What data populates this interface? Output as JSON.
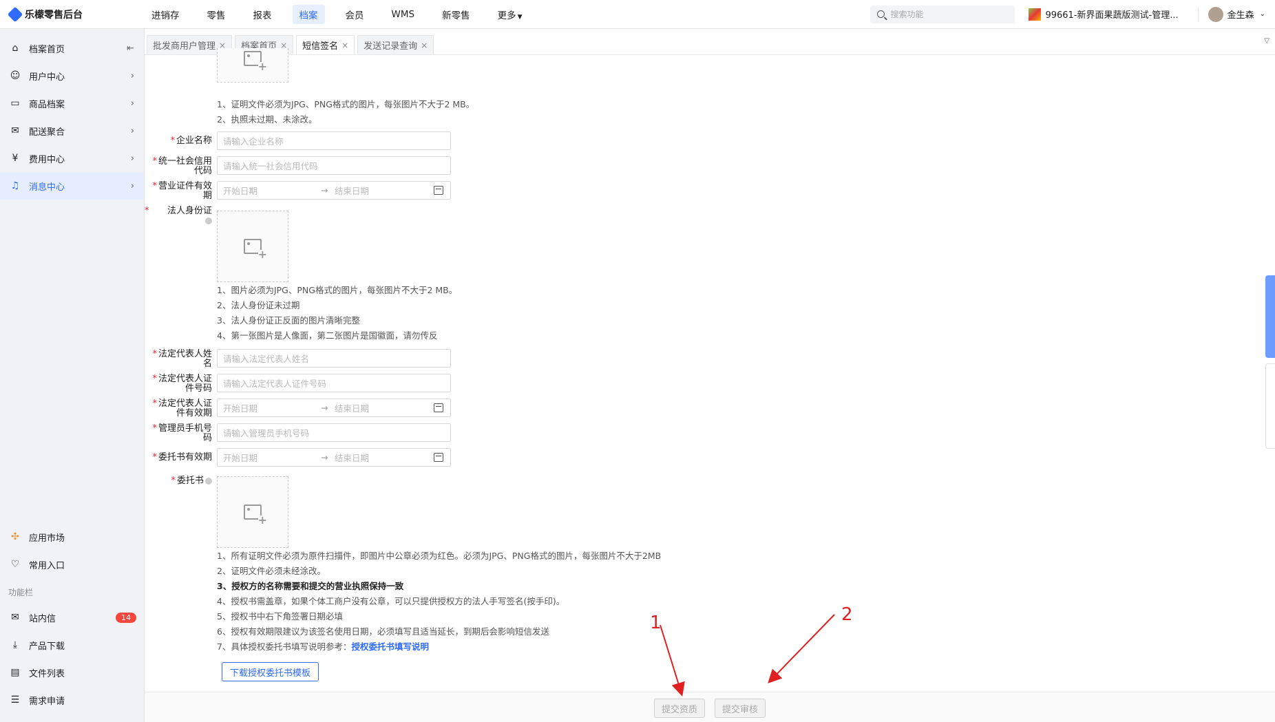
{
  "app": {
    "title": "乐檬零售后台"
  },
  "topnav": [
    {
      "label": "进销存",
      "active": false
    },
    {
      "label": "零售",
      "active": false
    },
    {
      "label": "报表",
      "active": false
    },
    {
      "label": "档案",
      "active": true
    },
    {
      "label": "会员",
      "active": false
    },
    {
      "label": "WMS",
      "active": false
    },
    {
      "label": "新零售",
      "active": false
    },
    {
      "label": "更多",
      "active": false
    }
  ],
  "search": {
    "placeholder": "搜索功能"
  },
  "store": {
    "name": "99661-新界面果蔬版测试-管理..."
  },
  "user": {
    "name": "金生森"
  },
  "sidebar": {
    "items": [
      {
        "label": "档案首页",
        "icon": "home-icon"
      },
      {
        "label": "用户中心",
        "icon": "user-icon"
      },
      {
        "label": "商品档案",
        "icon": "goods-icon"
      },
      {
        "label": "配送聚合",
        "icon": "delivery-icon"
      },
      {
        "label": "费用中心",
        "icon": "fee-icon"
      },
      {
        "label": "消息中心",
        "icon": "bell-icon",
        "active": true
      }
    ],
    "bottom": [
      {
        "label": "应用市场",
        "icon": "app-market-icon"
      },
      {
        "label": "常用入口",
        "icon": "heart-icon"
      }
    ],
    "section_title": "功能栏",
    "tools": [
      {
        "label": "站内信",
        "icon": "mail-icon",
        "badge": "14"
      },
      {
        "label": "产品下载",
        "icon": "download-icon"
      },
      {
        "label": "文件列表",
        "icon": "file-list-icon"
      },
      {
        "label": "需求申请",
        "icon": "request-icon"
      }
    ]
  },
  "tabs": [
    {
      "label": "批发商用户管理",
      "active": false
    },
    {
      "label": "档案首页",
      "active": false
    },
    {
      "label": "短信签名",
      "active": true
    },
    {
      "label": "发送记录查询",
      "active": false
    }
  ],
  "form": {
    "cert_hints": [
      "1、证明文件必须为JPG、PNG格式的图片，每张图片不大于2 MB。",
      "2、执照未过期、未涂改。"
    ],
    "company_name": {
      "label": "企业名称",
      "placeholder": "请输入企业名称"
    },
    "credit_code": {
      "label": "统一社会信用代码",
      "placeholder": "请输入统一社会信用代码"
    },
    "license_valid": {
      "label": "营业证件有效期",
      "start": "开始日期",
      "end": "结束日期"
    },
    "legal_id": {
      "label": "法人身份证"
    },
    "legal_id_hints": [
      "1、图片必须为JPG、PNG格式的图片，每张图片不大于2 MB。",
      "2、法人身份证未过期",
      "3、法人身份证正反面的图片清晰完整",
      "4、第一张图片是人像面，第二张图片是国徽面，请勿传反"
    ],
    "legal_name": {
      "label": "法定代表人姓名",
      "placeholder": "请输入法定代表人姓名"
    },
    "legal_cert_no": {
      "label": "法定代表人证件号码",
      "placeholder": "请输入法定代表人证件号码"
    },
    "legal_cert_valid": {
      "label": "法定代表人证件有效期",
      "start": "开始日期",
      "end": "结束日期"
    },
    "admin_phone": {
      "label": "管理员手机号码",
      "placeholder": "请输入管理员手机号码"
    },
    "auth_valid": {
      "label": "委托书有效期",
      "start": "开始日期",
      "end": "结束日期"
    },
    "auth_letter": {
      "label": "委托书"
    },
    "auth_hints": [
      "1、所有证明文件必须为原件扫描件，即图片中公章必须为红色。必须为JPG、PNG格式的图片，每张图片不大于2MB",
      "2、证明文件必须未经涂改。",
      "3、授权方的名称需要和提交的营业执照保持一致",
      "4、授权书需盖章，如果个体工商户没有公章，可以只提供授权方的法人手写签名(按手印)。",
      "5、授权书中右下角签署日期必填",
      "6、授权有效期限建议为该签名使用日期，必须填写且适当延长，到期后会影响短信发送",
      "7、具体授权委托书填写说明参考："
    ],
    "auth_link": "授权委托书填写说明",
    "download_button": "下载授权委托书模板"
  },
  "footer": {
    "submit_qualification": "提交资质",
    "submit_review": "提交审核"
  },
  "annotations": [
    "1",
    "2"
  ],
  "colors": {
    "accent": "#2f6bff",
    "required": "#f5222d",
    "annotation": "#e02020"
  }
}
